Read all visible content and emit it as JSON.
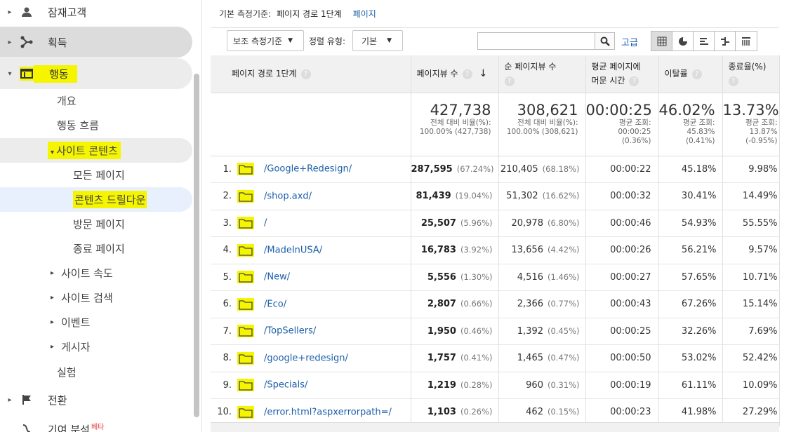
{
  "sidebar": {
    "top_item": "잠재고객",
    "acquisition": "획득",
    "behavior": "행동",
    "overview": "개요",
    "behavior_flow": "행동 흐름",
    "site_content": "사이트 콘텐츠",
    "all_pages": "모든 페이지",
    "content_drilldown": "콘텐츠 드릴다운",
    "landing_pages": "방문 페이지",
    "exit_pages": "종료 페이지",
    "site_speed": "사이트 속도",
    "site_search": "사이트 검색",
    "events": "이벤트",
    "publisher": "게시자",
    "experiments": "실험",
    "conversions": "전환",
    "attribution": "기여 분석",
    "beta": "베타"
  },
  "dimension_bar": {
    "label": "기본 측정기준:",
    "current": "페이지 경로 1단계",
    "link": "페이지"
  },
  "toolbar": {
    "secondary_dim": "보조 측정기준",
    "sort_label": "정렬 유형:",
    "sort_value": "기본",
    "search_placeholder": "",
    "advanced": "고급"
  },
  "table": {
    "headers": {
      "page_path": "페이지 경로 1단계",
      "pageviews": "페이지뷰 수",
      "unique_pageviews": "순 페이지뷰 수",
      "avg_time_1": "평균 페이지에",
      "avg_time_2": "머문 시간",
      "bounce": "이탈률",
      "exit": "종료율(%)"
    },
    "summary": {
      "pageviews": "427,738",
      "pageviews_sub1": "전체 대비 비율(%):",
      "pageviews_sub2": "100.00% (427,738)",
      "unique": "308,621",
      "unique_sub1": "전체 대비 비율(%):",
      "unique_sub2": "100.00% (308,621)",
      "avg_time": "00:00:25",
      "avg_time_sub1": "평균 조회:",
      "avg_time_sub2": "00:00:25",
      "avg_time_sub3": "(0.36%)",
      "bounce": "46.02%",
      "bounce_sub1": "평균 조회:",
      "bounce_sub2": "45.83%",
      "bounce_sub3": "(0.41%)",
      "exit": "13.73%",
      "exit_sub1": "평균 조회:",
      "exit_sub2": "13.87%",
      "exit_sub3": "(-0.95%)"
    },
    "rows": [
      {
        "rank": "1.",
        "path": "/Google+Redesign/",
        "pv": "287,595",
        "pv_pct": "(67.24%)",
        "upv": "210,405",
        "upv_pct": "(68.18%)",
        "time": "00:00:22",
        "bounce": "45.18%",
        "exit": "9.98%"
      },
      {
        "rank": "2.",
        "path": "/shop.axd/",
        "pv": "81,439",
        "pv_pct": "(19.04%)",
        "upv": "51,302",
        "upv_pct": "(16.62%)",
        "time": "00:00:32",
        "bounce": "30.41%",
        "exit": "14.49%"
      },
      {
        "rank": "3.",
        "path": "/",
        "pv": "25,507",
        "pv_pct": "(5.96%)",
        "upv": "20,978",
        "upv_pct": "(6.80%)",
        "time": "00:00:46",
        "bounce": "54.93%",
        "exit": "55.55%"
      },
      {
        "rank": "4.",
        "path": "/MadeInUSA/",
        "pv": "16,783",
        "pv_pct": "(3.92%)",
        "upv": "13,656",
        "upv_pct": "(4.42%)",
        "time": "00:00:26",
        "bounce": "56.21%",
        "exit": "9.57%"
      },
      {
        "rank": "5.",
        "path": "/New/",
        "pv": "5,556",
        "pv_pct": "(1.30%)",
        "upv": "4,516",
        "upv_pct": "(1.46%)",
        "time": "00:00:27",
        "bounce": "57.65%",
        "exit": "10.71%"
      },
      {
        "rank": "6.",
        "path": "/Eco/",
        "pv": "2,807",
        "pv_pct": "(0.66%)",
        "upv": "2,366",
        "upv_pct": "(0.77%)",
        "time": "00:00:43",
        "bounce": "67.26%",
        "exit": "15.14%"
      },
      {
        "rank": "7.",
        "path": "/TopSellers/",
        "pv": "1,950",
        "pv_pct": "(0.46%)",
        "upv": "1,392",
        "upv_pct": "(0.45%)",
        "time": "00:00:25",
        "bounce": "32.26%",
        "exit": "7.69%"
      },
      {
        "rank": "8.",
        "path": "/google+redesign/",
        "pv": "1,757",
        "pv_pct": "(0.41%)",
        "upv": "1,465",
        "upv_pct": "(0.47%)",
        "time": "00:00:50",
        "bounce": "53.02%",
        "exit": "52.42%"
      },
      {
        "rank": "9.",
        "path": "/Specials/",
        "pv": "1,219",
        "pv_pct": "(0.28%)",
        "upv": "960",
        "upv_pct": "(0.31%)",
        "time": "00:00:19",
        "bounce": "61.11%",
        "exit": "10.09%"
      },
      {
        "rank": "10.",
        "path": "/error.html?aspxerrorpath=/",
        "pv": "1,103",
        "pv_pct": "(0.26%)",
        "upv": "462",
        "upv_pct": "(0.15%)",
        "time": "00:00:23",
        "bounce": "41.98%",
        "exit": "27.29%"
      }
    ]
  },
  "colors": {
    "highlight": "#f5f500",
    "link": "#1a5ea8"
  }
}
